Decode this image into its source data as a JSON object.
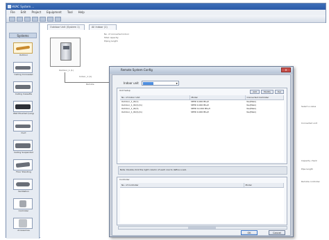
{
  "app": {
    "title": "HVAC System ..."
  },
  "menu": [
    "File",
    "Edit",
    "Project",
    "Equipment",
    "Tool",
    "Help"
  ],
  "sidebar": {
    "header": "Systems",
    "items": [
      {
        "label": "Outdoor"
      },
      {
        "label": "Ceiling Concealed"
      },
      {
        "label": "Ceiling Cassette"
      },
      {
        "label": "Wall Mounted (Large)"
      },
      {
        "label": "Duct"
      },
      {
        "label": "Ceiling Suspended"
      },
      {
        "label": "Floor Standing"
      },
      {
        "label": "Ventilation"
      },
      {
        "label": "Controller"
      },
      {
        "label": "Accessories"
      }
    ]
  },
  "canvas": {
    "tabs": [
      "Outdoor Unit (System 1)",
      "All Indoor (1)"
    ],
    "node_label": "Outdoor_1 (1)",
    "node_note": "Outdoor_1",
    "branch_labels": [
      "Indoor_1 (1)",
      "Remote"
    ],
    "top_notes": [
      "No. of connected indoor",
      "Total capacity",
      "Piping length"
    ],
    "right_notes": [
      "Select a value",
      "Connected unit",
      "Capacity check",
      "Pipe length",
      "Remote controller"
    ]
  },
  "dialog": {
    "title": "Remote System Config",
    "field_label": "Indoor unit",
    "field_value": "1",
    "group1_label": "Unit Setup",
    "buttons": [
      "Add",
      "Modify",
      "Del"
    ],
    "table1": {
      "columns": [
        "No. of Indoor Unit",
        "Model",
        "Connected Controller"
      ],
      "rows": [
        [
          "Outdoor_1_ID(1)",
          "SEER 9,000 Btu/h",
          "Yes(Main)"
        ],
        [
          "Outdoor_1_ID(2)(m)",
          "SEER 9,000 Btu/h",
          "Yes(Main)"
        ],
        [
          "Outdoor_1_ID(3)",
          "SEER 12,000 Btu/h",
          "Yes(Main)"
        ],
        [
          "Outdoor_1_ID(4)(m)",
          "SEER 9,000 Btu/h",
          "Yes(Main)"
        ]
      ]
    },
    "hint": "Note: Double click the right column of each row to define a sub.",
    "group2_label": "Controller",
    "table2": {
      "columns": [
        "No. of Controller",
        "Model"
      ],
      "rows": []
    },
    "ok_label": "OK",
    "cancel_label": "Cancel"
  }
}
